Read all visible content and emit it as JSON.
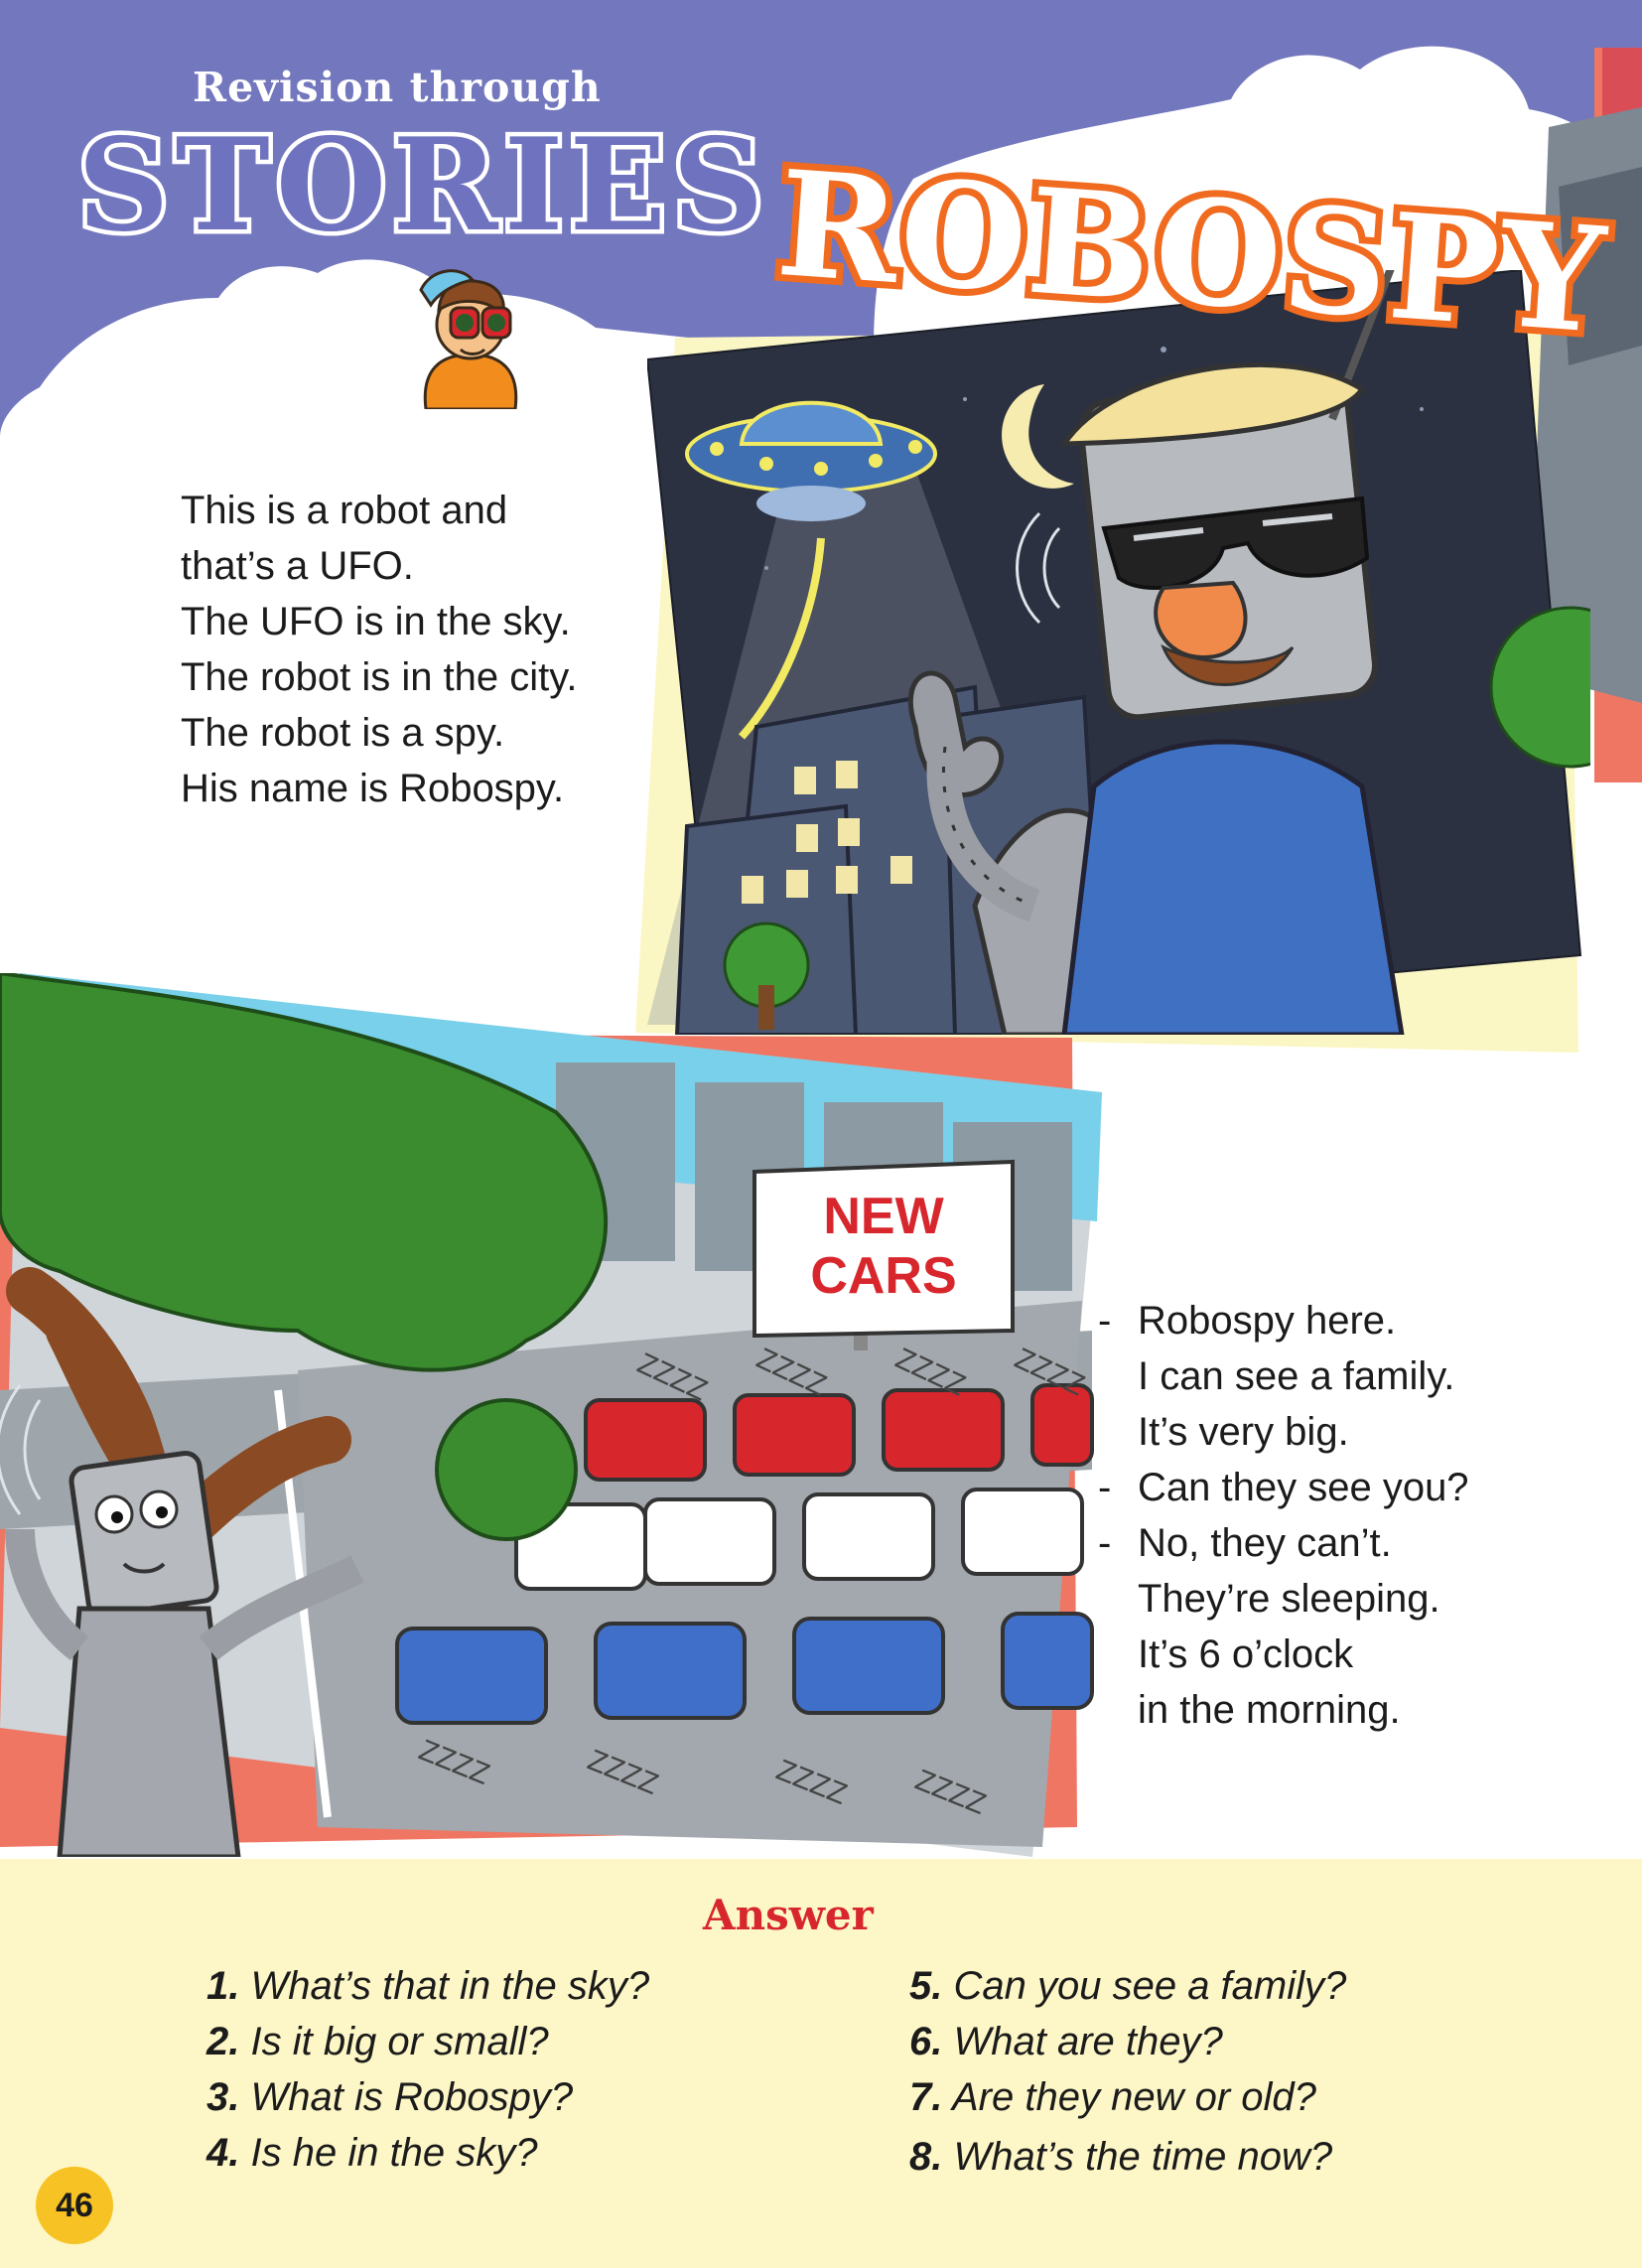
{
  "header": {
    "kicker": "Revision through",
    "series": "STORIES",
    "story_title": "ROBOSPY",
    "colors": {
      "header_bg": "#7377bd",
      "title_orange": "#f06b1f"
    }
  },
  "story_part1": {
    "lines": [
      "This is a robot and",
      "that’s a UFO.",
      "The UFO is in the sky.",
      "The robot is in the city.",
      "The robot is a spy.",
      "His name is Robospy."
    ]
  },
  "illustration1": {
    "icon": "robot-spy-ufo-night-city"
  },
  "illustration2": {
    "sign": [
      "NEW",
      "CARS"
    ],
    "snore": [
      "Z",
      "Z",
      "Z",
      "Z"
    ],
    "icon": "robot-behind-tree-car-lot"
  },
  "dialogue": {
    "lines": [
      {
        "dash": "-",
        "text": "Robospy here."
      },
      {
        "dash": "",
        "text": "I can see a family."
      },
      {
        "dash": "",
        "text": "It’s very big."
      },
      {
        "dash": "-",
        "text": "Can they see you?"
      },
      {
        "dash": "-",
        "text": "No, they can’t."
      },
      {
        "dash": "",
        "text": "They’re sleeping."
      },
      {
        "dash": "",
        "text": "It’s 6 o’clock"
      },
      {
        "dash": "",
        "text": "in the morning."
      }
    ]
  },
  "answer": {
    "title": "Answer",
    "left": [
      {
        "num": "1.",
        "text": "What’s that in the sky?"
      },
      {
        "num": "2.",
        "text": "Is it big or small?"
      },
      {
        "num": "3.",
        "text": "What is Robospy?"
      },
      {
        "num": "4.",
        "text": "Is he in the sky?"
      }
    ],
    "right": [
      {
        "num": "5.",
        "text": "Can you see a family?"
      },
      {
        "num": "6.",
        "text": "What are they?"
      },
      {
        "num": "7.",
        "text": "Are they new or old?"
      },
      {
        "num": "8.",
        "text": "What’s the time now?"
      }
    ]
  },
  "page_number": "46"
}
